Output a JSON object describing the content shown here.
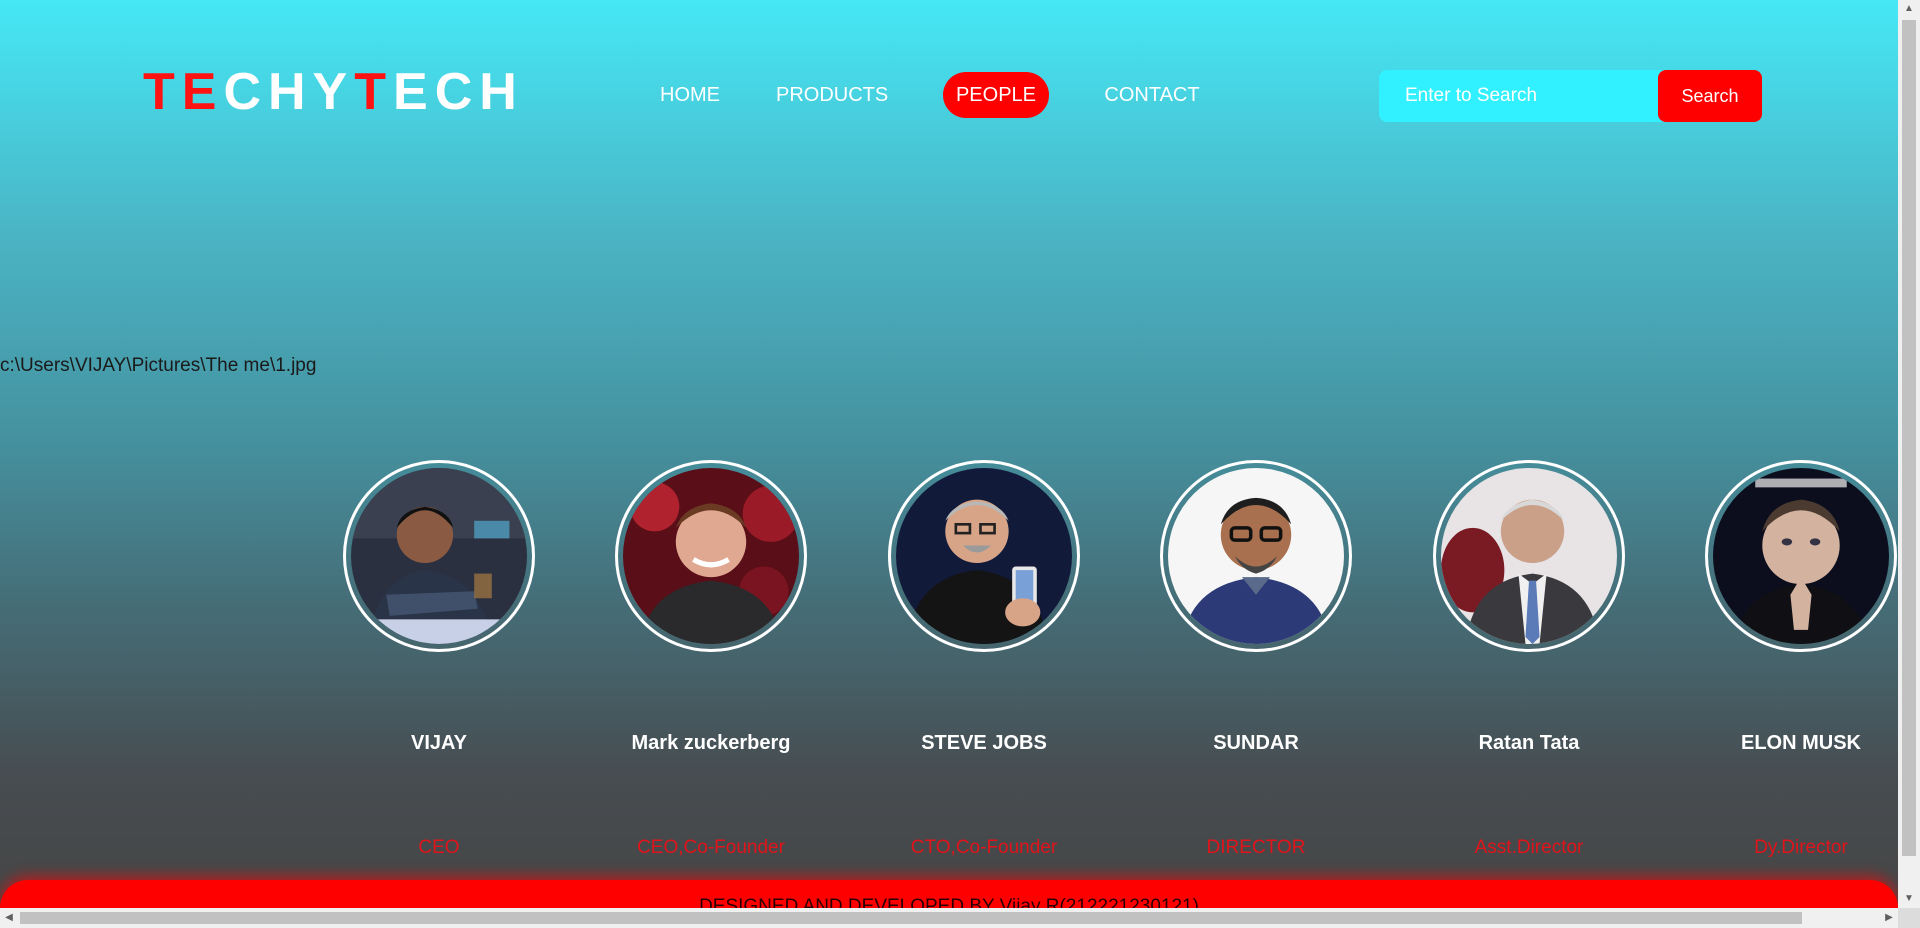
{
  "logo": {
    "parts": [
      {
        "text": "TE",
        "color": "red"
      },
      {
        "text": "CHY",
        "color": "white"
      },
      {
        "text": "T",
        "color": "red"
      },
      {
        "text": "ECH",
        "color": "white"
      }
    ]
  },
  "nav": {
    "home": "HOME",
    "products": "PRODUCTS",
    "people": "PEOPLE",
    "contact": "CONTACT",
    "active": "PEOPLE"
  },
  "search": {
    "placeholder": "Enter to Search",
    "button_label": "Search"
  },
  "path_text": "c:\\Users\\VIJAY\\Pictures\\The me\\1.jpg",
  "people": [
    {
      "name": "VIJAY",
      "role": "CEO"
    },
    {
      "name": "Mark zuckerberg",
      "role": "CEO,Co-Founder"
    },
    {
      "name": "STEVE JOBS",
      "role": "CTO,Co-Founder"
    },
    {
      "name": "SUNDAR",
      "role": "DIRECTOR"
    },
    {
      "name": "Ratan Tata",
      "role": "Asst.Director"
    },
    {
      "name": "ELON MUSK",
      "role": "Dy.Director"
    }
  ],
  "footer": {
    "text": "DESIGNED AND DEVELOPED BY Vijay R(212221230121)"
  },
  "colors": {
    "accent_red": "#ff0000",
    "search_bg": "#31f0ff",
    "top_gradient": "#45e8f6",
    "bottom_gradient": "#464646"
  }
}
